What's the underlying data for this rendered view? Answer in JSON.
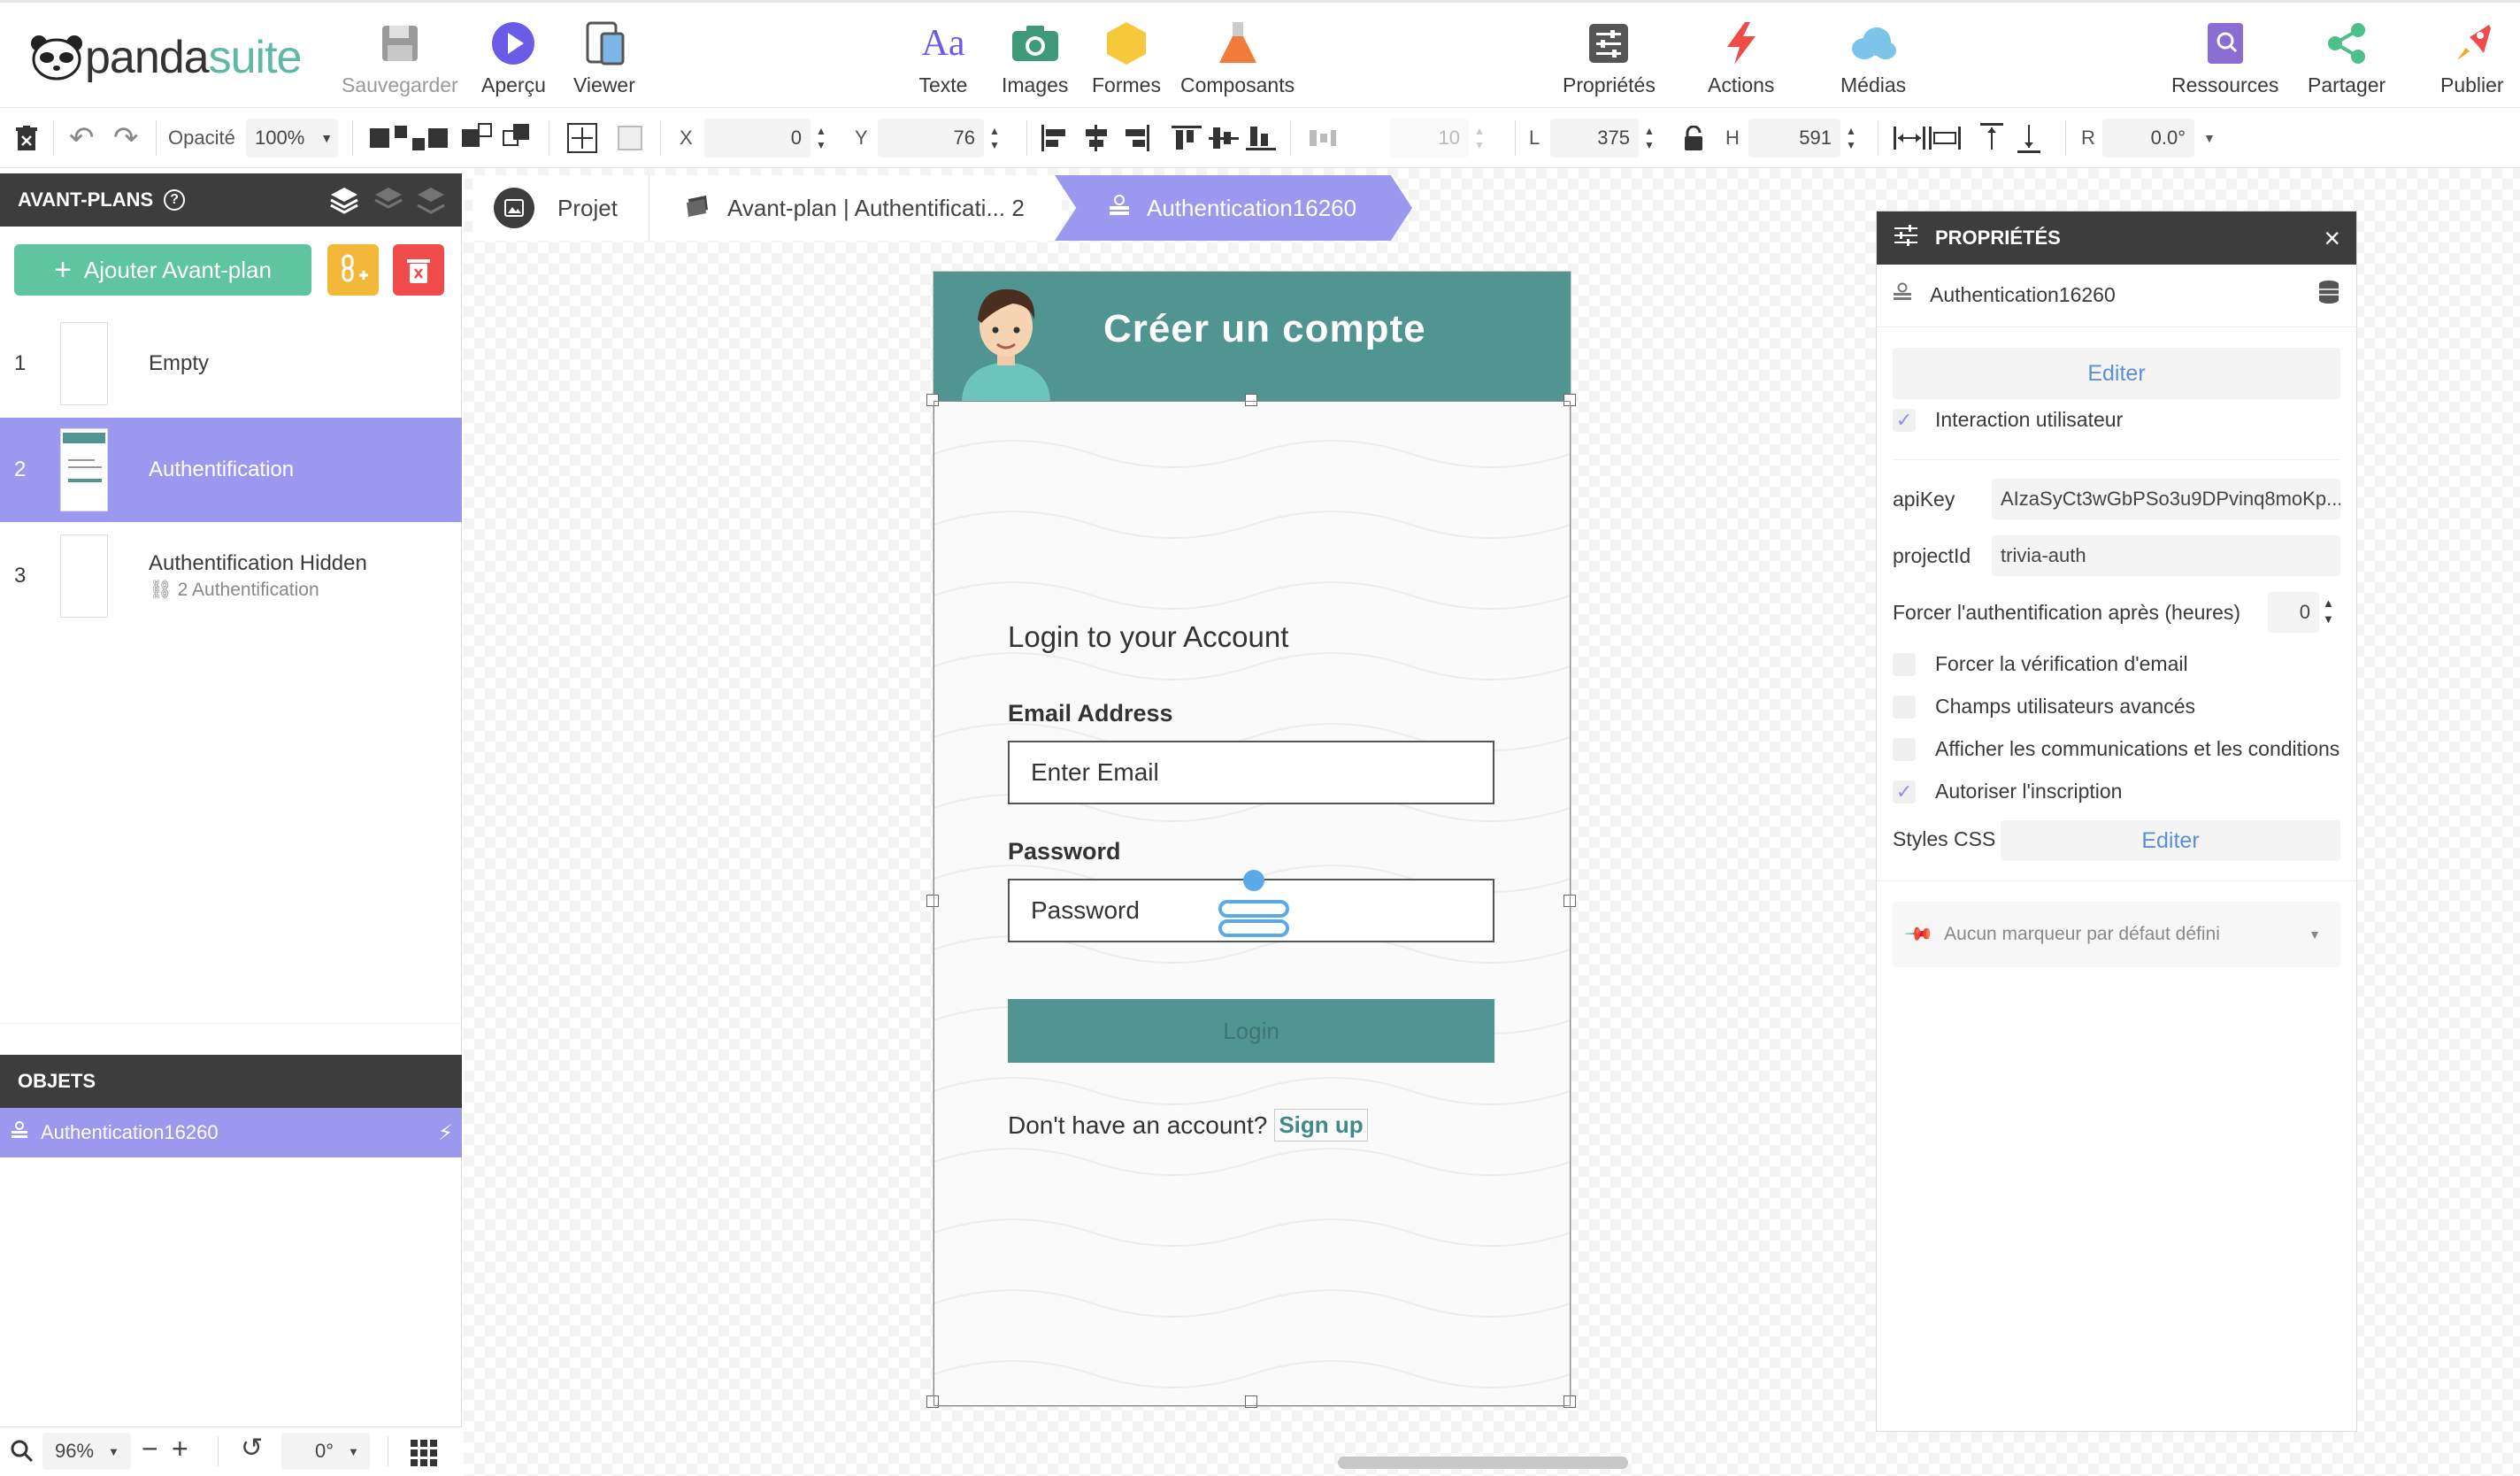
{
  "logo": {
    "part1": "panda",
    "part2": "suite"
  },
  "topbar": {
    "save": "Sauvegarder",
    "preview": "Aperçu",
    "viewer": "Viewer",
    "text": "Texte",
    "images": "Images",
    "shapes": "Formes",
    "components": "Composants",
    "properties": "Propriétés",
    "actions": "Actions",
    "media": "Médias",
    "resources": "Ressources",
    "share": "Partager",
    "publish": "Publier"
  },
  "toolbar2": {
    "opacity_label": "Opacité",
    "opacity_value": "100%",
    "x_label": "X",
    "x_value": "0",
    "y_label": "Y",
    "y_value": "76",
    "spacing_value": "10",
    "l_label": "L",
    "l_value": "375",
    "h_label": "H",
    "h_value": "591",
    "r_label": "R",
    "r_value": "0.0°"
  },
  "left": {
    "header": "AVANT-PLANS",
    "add_button": "Ajouter Avant-plan",
    "pages": [
      {
        "num": "1",
        "title": "Empty",
        "sub": ""
      },
      {
        "num": "2",
        "title": "Authentification",
        "sub": ""
      },
      {
        "num": "3",
        "title": "Authentification Hidden",
        "sub": "2  Authentification"
      }
    ],
    "objects_header": "OBJETS",
    "object_item": "Authentication16260",
    "zoom": "96%",
    "rotation": "0°"
  },
  "breadcrumb": {
    "project": "Projet",
    "page": "Avant-plan | Authentificati... 2",
    "object": "Authentication16260"
  },
  "phone": {
    "header_title": "Créer un compte",
    "login_title": "Login to your Account",
    "email_label": "Email Address",
    "email_placeholder": "Enter Email",
    "password_label": "Password",
    "password_placeholder": "Password",
    "login_button": "Login",
    "signup_text": "Don't have an account?",
    "signup_link": "Sign up"
  },
  "right": {
    "header": "PROPRIÉTÉS",
    "object_name": "Authentication16260",
    "edit_button": "Editer",
    "user_interaction": "Interaction utilisateur",
    "apikey_label": "apiKey",
    "apikey_value": "AIzaSyCt3wGbPSo3u9DPvinq8moKp...",
    "projectid_label": "projectId",
    "projectid_value": "trivia-auth",
    "force_auth_label": "Forcer l'authentification après (heures)",
    "force_auth_value": "0",
    "force_email": "Forcer la vérification d'email",
    "advanced_fields": "Champs utilisateurs avancés",
    "show_comms": "Afficher les communications et les conditions",
    "allow_signup": "Autoriser l'inscription",
    "css_label": "Styles CSS",
    "css_button": "Editer",
    "marker": "Aucun marqueur par défaut défini"
  },
  "colors": {
    "accent": "#9a99ef",
    "teal": "#519593",
    "green": "#5fc4a0",
    "link": "#5b8fd6"
  }
}
